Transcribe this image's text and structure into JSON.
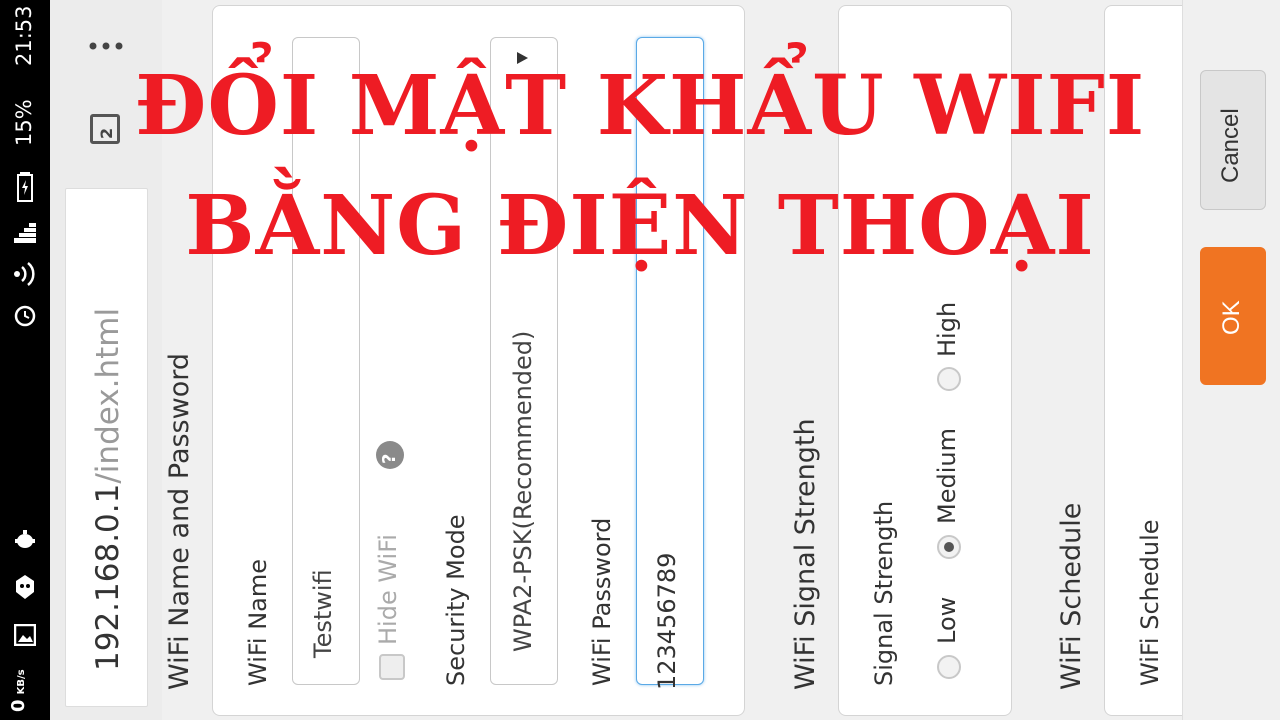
{
  "status_bar": {
    "time": "21:53",
    "battery": "15%",
    "data_speed_value": "0",
    "data_speed_unit": "KB/s",
    "icons": [
      "battery-icon",
      "signal-icon",
      "wifi-icon",
      "alarm-icon",
      "android-debug-icon",
      "notification-icon",
      "image-icon"
    ]
  },
  "browser": {
    "menu_icon": "more-dots-icon",
    "tab_count": "2",
    "url_host": "192.168.0.1",
    "url_path": "/index.html"
  },
  "sections": {
    "name_password": "WiFi Name and Password",
    "signal_strength": "WiFi Signal Strength",
    "schedule": "WiFi Schedule"
  },
  "form": {
    "wifi_name_label": "WiFi Name",
    "wifi_name_value": "Testwifi",
    "hide_wifi_label": "Hide WiFi",
    "help_glyph": "?",
    "security_mode_label": "Security Mode",
    "security_mode_value": "WPA2-PSK(Recommended)",
    "wifi_password_label": "WiFi Password",
    "wifi_password_value": "123456789",
    "signal_strength_label": "Signal Strength",
    "signal_options": [
      "Low",
      "Medium",
      "High"
    ],
    "signal_selected": "Medium",
    "schedule_label": "WiFi Schedule"
  },
  "buttons": {
    "cancel": "Cancel",
    "ok": "OK"
  },
  "overlay": {
    "line1": "ĐỔI MẬT KHẨU WIFI",
    "line2": "BẰNG ĐIỆN THOẠI"
  },
  "colors": {
    "accent": "#f07422",
    "overlay_text": "#ee1c24",
    "focus_border": "#5aa9e6"
  }
}
